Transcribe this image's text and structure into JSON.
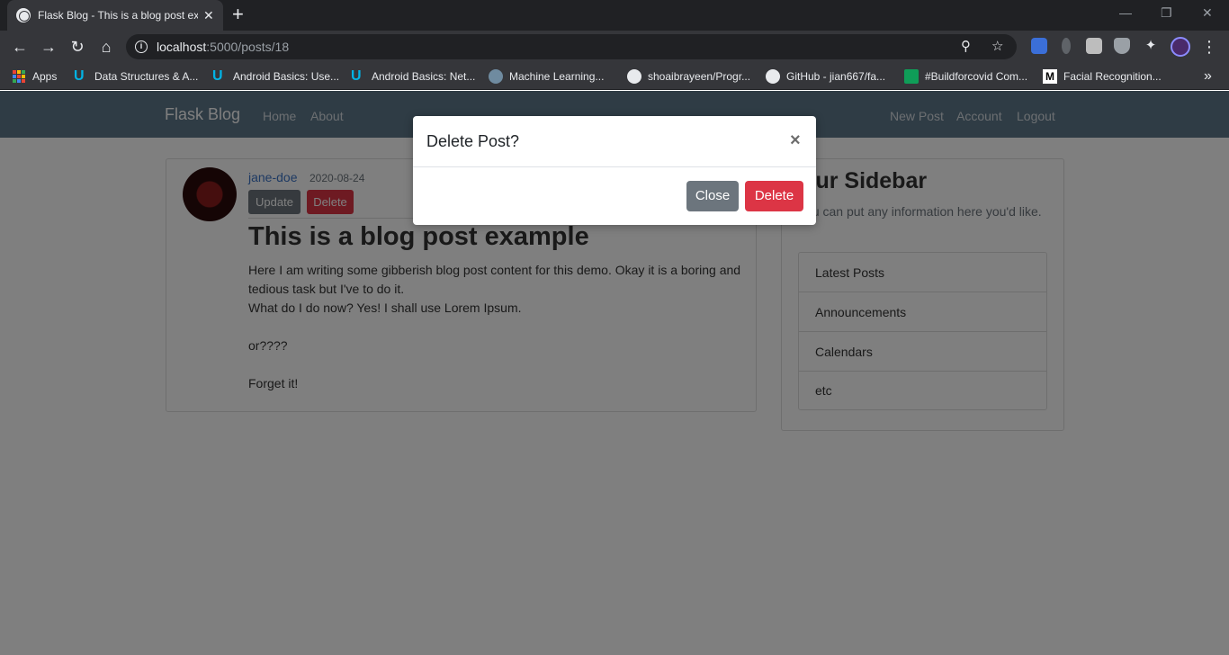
{
  "browser": {
    "tab_title": "Flask Blog - This is a blog post example",
    "tab_close": "✕",
    "new_tab": "+",
    "url_host": "localhost",
    "url_path": ":5000/posts/18",
    "back": "←",
    "forward": "→",
    "reload": "↻",
    "home": "⌂",
    "zoom_icon": "⚲",
    "star_icon": "☆",
    "menu_icon": "⋮",
    "window_min": "—",
    "window_restore": "❐",
    "window_close": "✕",
    "bookmarks": [
      {
        "label": "Apps"
      },
      {
        "label": "Data Structures & A..."
      },
      {
        "label": "Android Basics: Use..."
      },
      {
        "label": "Android Basics: Net..."
      },
      {
        "label": "Machine Learning..."
      },
      {
        "label": "shoaibrayeen/Progr..."
      },
      {
        "label": "GitHub - jian667/fa..."
      },
      {
        "label": "#Buildforcovid Com..."
      },
      {
        "label": "Facial Recognition..."
      }
    ],
    "bookmarks_more": "»"
  },
  "site": {
    "brand": "Flask Blog",
    "nav_left": [
      "Home",
      "About"
    ],
    "nav_right": [
      "New Post",
      "Account",
      "Logout"
    ]
  },
  "post": {
    "author": "jane-doe",
    "date": "2020-08-24",
    "update_label": "Update",
    "delete_label": "Delete",
    "title": "This is a blog post example",
    "content": [
      "Here I am writing some gibberish blog post content for this demo. Okay it is a boring and tedious task but I've to do it.",
      "What do I do now? Yes! I shall use Lorem Ipsum.",
      "",
      "or????",
      "",
      "Forget it!"
    ]
  },
  "sidebar": {
    "title": "Our Sidebar",
    "text": "You can put any information here you'd like.",
    "items": [
      "Latest Posts",
      "Announcements",
      "Calendars",
      "etc"
    ]
  },
  "modal": {
    "title": "Delete Post?",
    "close_x": "×",
    "close_label": "Close",
    "delete_label": "Delete"
  }
}
